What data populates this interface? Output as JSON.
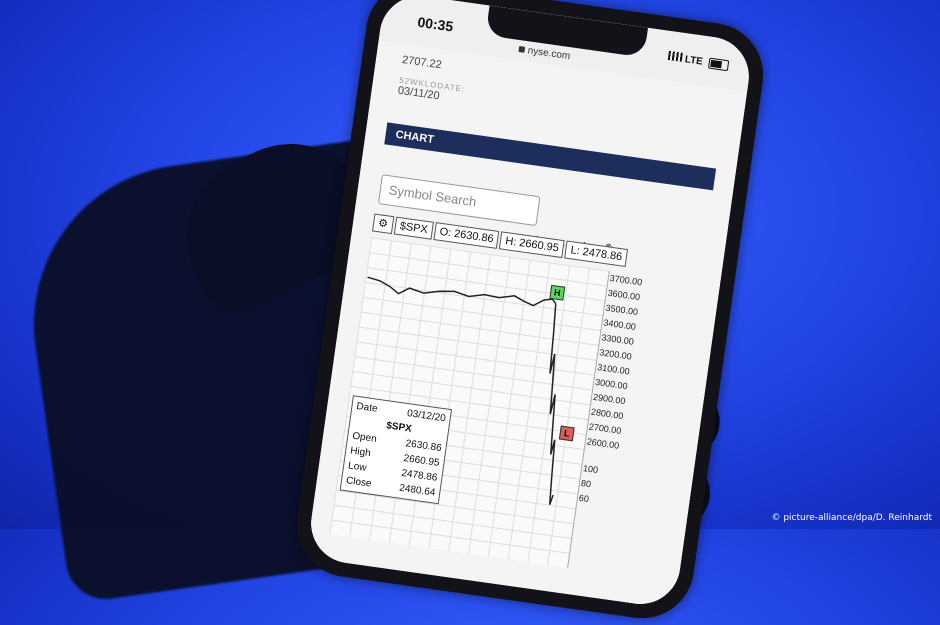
{
  "status": {
    "time": "00:35",
    "url": "nyse.com",
    "network": "LTE"
  },
  "meta": {
    "value": "2707.22",
    "date_label": "52WKLODATE:",
    "date": "03/11/20"
  },
  "chart_section": {
    "header": "CHART"
  },
  "search": {
    "placeholder": "Symbol Search"
  },
  "toolbar": {
    "icons": [
      "plus-icon",
      "arrows-icon",
      "line-icon",
      "wave-icon",
      "eraser-icon"
    ]
  },
  "ohlc": {
    "symbol": "$SPX",
    "open": "O: 2630.86",
    "high": "H: 2660.95",
    "low": "L: 2478.86"
  },
  "y_axis": {
    "ticks": [
      "3700.00",
      "3600.00",
      "3500.00",
      "3400.00",
      "3300.00",
      "3200.00",
      "3100.00",
      "3000.00",
      "2900.00",
      "2800.00",
      "2700.00",
      "2600.00"
    ],
    "volume_ticks": [
      "100",
      "80",
      "60"
    ]
  },
  "badges": {
    "high": "H",
    "low": "L"
  },
  "tooltip": {
    "date_label": "Date",
    "date": "03/12/20",
    "symbol": "$SPX",
    "rows": [
      {
        "label": "Open",
        "value": "2630.86"
      },
      {
        "label": "High",
        "value": "2660.95"
      },
      {
        "label": "Low",
        "value": "2478.86"
      },
      {
        "label": "Close",
        "value": "2480.64"
      }
    ]
  },
  "colors": {
    "background": "#2448e8",
    "header": "#1d2d5c",
    "high_badge": "#5cd65c",
    "low_badge": "#e05a5a"
  },
  "credit": "© picture-alliance/dpa/D. Reinhardt"
}
